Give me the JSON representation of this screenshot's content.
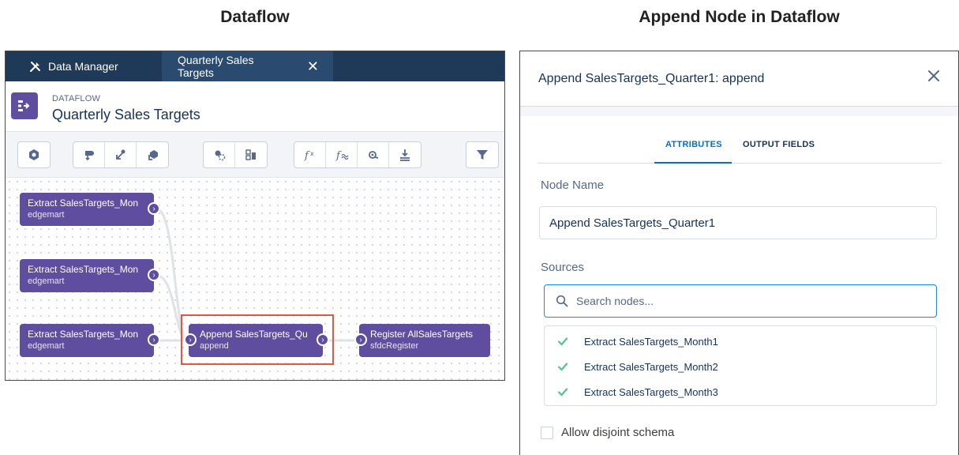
{
  "captions": {
    "left": "Dataflow",
    "right": "Append Node in Dataflow"
  },
  "dataflow": {
    "tabs": {
      "home_label": "Data Manager",
      "home_icon": "tools-icon",
      "active_label": "Quarterly Sales Targets",
      "close_icon": "close-icon"
    },
    "header": {
      "kicker": "DATAFLOW",
      "title": "Quarterly Sales Targets",
      "icon": "dataflow-icon"
    },
    "toolbar": {
      "groups": [
        [
          "dataset-builder-icon"
        ],
        [
          "sfdc-digest-icon",
          "digest-icon",
          "edgemart-icon"
        ],
        [
          "append-icon",
          "augment-icon"
        ],
        [
          "compute-expression-icon",
          "compute-relative-icon",
          "flatten-icon",
          "register-icon"
        ],
        [
          "filter-icon"
        ]
      ]
    },
    "nodes": [
      {
        "title": "Extract SalesTargets_Mon",
        "subtitle": "edgemart"
      },
      {
        "title": "Extract SalesTargets_Mon",
        "subtitle": "edgemart"
      },
      {
        "title": "Extract SalesTargets_Mon",
        "subtitle": "edgemart"
      },
      {
        "title": "Append SalesTargets_Qu",
        "subtitle": "append"
      },
      {
        "title": "Register AllSalesTargets",
        "subtitle": "sfdcRegister"
      }
    ],
    "node_color": "#5f4ea0",
    "highlight_color": "#e8553e"
  },
  "panel": {
    "title": "Append SalesTargets_Quarter1: append",
    "tabs": {
      "attributes": "ATTRIBUTES",
      "output_fields": "OUTPUT FIELDS",
      "active": "attributes"
    },
    "node_name_label": "Node Name",
    "node_name_value": "Append SalesTargets_Quarter1",
    "sources_label": "Sources",
    "search_placeholder": "Search nodes...",
    "sources": [
      {
        "label": "Extract SalesTargets_Month1",
        "checked": true
      },
      {
        "label": "Extract SalesTargets_Month2",
        "checked": true
      },
      {
        "label": "Extract SalesTargets_Month3",
        "checked": true
      }
    ],
    "check_color": "#4bca81",
    "accent_color": "#0070d2",
    "disjoint_label": "Allow disjoint schema",
    "disjoint_checked": false
  }
}
